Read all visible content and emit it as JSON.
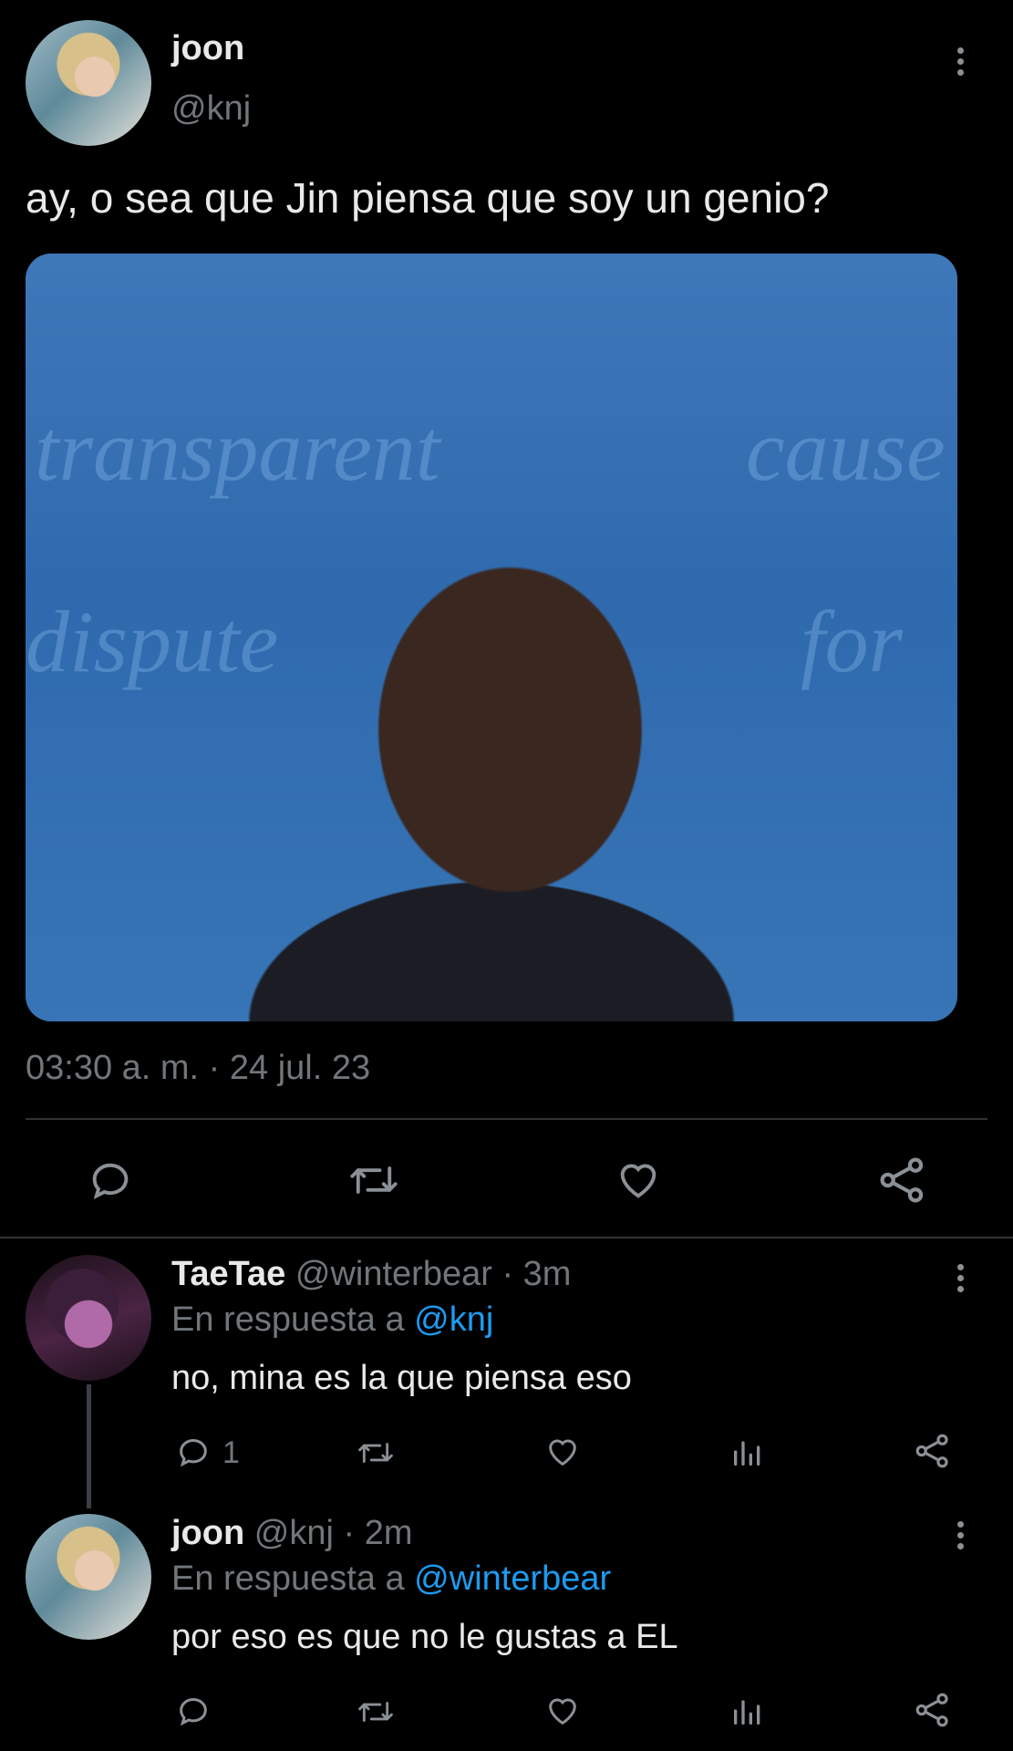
{
  "tweet": {
    "author_name": "joon",
    "author_handle": "@knj",
    "text": "ay, o sea que Jin piensa que soy un genio?",
    "timestamp": "03:30 a. m. · 24 jul. 23",
    "photo_overlay_words": [
      "transparent",
      "cause",
      "dispute",
      "for"
    ]
  },
  "actions": {
    "reply_icon": "reply-icon",
    "retweet_icon": "retweet-icon",
    "like_icon": "like-icon",
    "share_icon": "share-icon"
  },
  "replies": [
    {
      "author_name": "TaeTae",
      "author_handle": "@winterbear",
      "time": "· 3m",
      "replying_prefix": "En respuesta a",
      "replying_to": "@knj",
      "text": "no, mina es la que piensa eso",
      "reply_count": "1"
    },
    {
      "author_name": "joon",
      "author_handle": "@knj",
      "time": "· 2m",
      "replying_prefix": "En respuesta a",
      "replying_to": "@winterbear",
      "text": "por eso es que no le gustas a EL",
      "reply_count": ""
    }
  ],
  "colors": {
    "background": "#000000",
    "text": "#e7e9ea",
    "muted": "#71767b",
    "link": "#1d9bf0"
  }
}
